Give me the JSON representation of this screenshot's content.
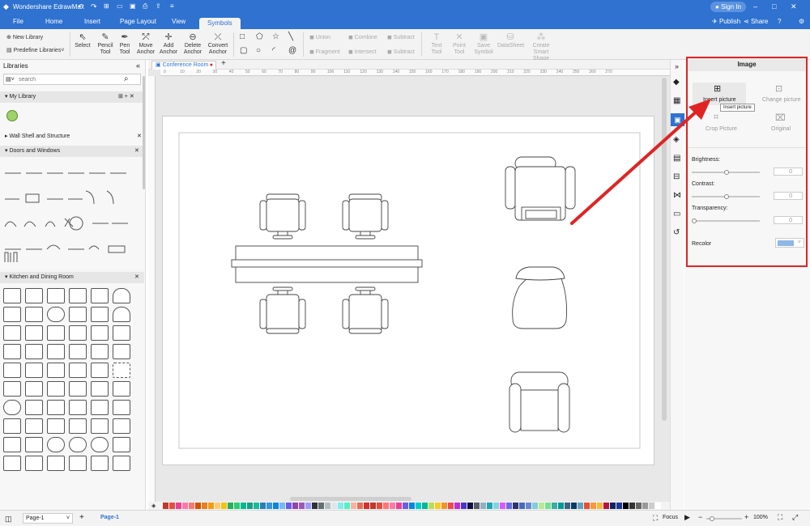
{
  "app": {
    "title": "Wondershare EdrawMax"
  },
  "title_right": {
    "sign_in": "Sign In",
    "publish": "Publish",
    "share": "Share"
  },
  "menu": [
    "File",
    "Home",
    "Insert",
    "Page Layout",
    "View",
    "Symbols"
  ],
  "ribbon": {
    "new_library": "New Library",
    "predefine_libraries": "Predefine Libraries",
    "select": "Select",
    "pencil_tool": [
      "Pencil",
      "Tool"
    ],
    "pen_tool": [
      "Pen",
      "Tool"
    ],
    "move_anchor": [
      "Move",
      "Anchor"
    ],
    "add_anchor": [
      "Add",
      "Anchor"
    ],
    "delete_anchor": [
      "Delete",
      "Anchor"
    ],
    "convert_anchor": [
      "Convert",
      "Anchor"
    ],
    "union": "Union",
    "combine": "Combine",
    "subtract": "Subtract",
    "fragment": "Fragment",
    "intersect": "Intersect",
    "subtract2": "Subtract",
    "text_tool": [
      "Text",
      "Tool"
    ],
    "point_tool": [
      "Point",
      "Tool"
    ],
    "save_symbol": [
      "Save",
      "Symbol"
    ],
    "datasheet": "DataSheet",
    "create_smart_shape": [
      "Create Smart",
      "Shape"
    ]
  },
  "libraries": {
    "title": "Libraries",
    "search_placeholder": "search",
    "sections": [
      "My Library",
      "Wall Shell and Structure",
      "Doors and Windows",
      "Kitchen and Dining Room"
    ]
  },
  "doc_tab": "Conference Room",
  "ruler_ticks": [
    "0",
    "10",
    "20",
    "30",
    "40",
    "50",
    "60",
    "70",
    "80",
    "90",
    "100",
    "110",
    "120",
    "130",
    "140",
    "150",
    "160",
    "170",
    "180",
    "190",
    "200",
    "210",
    "220",
    "230",
    "240",
    "250",
    "260",
    "270"
  ],
  "image_panel": {
    "title": "Image",
    "insert_picture": "Insert picture",
    "tooltip": "Insert picture",
    "change_picture": "Change picture",
    "crop_picture": "Crop Picture",
    "original": "Original",
    "brightness": "Brightness:",
    "brightness_value": "0",
    "contrast": "Contrast:",
    "contrast_value": "0",
    "transparency": "Transparency:",
    "transparency_value": "0",
    "recolor": "Recolor"
  },
  "status": {
    "page_select": "Page-1",
    "page_tab": "Page-1",
    "focus": "Focus",
    "zoom": "100%"
  },
  "colors": {
    "accent": "#2f72d0",
    "highlight": "#e02424",
    "palette": [
      "#c0392b",
      "#e74c3c",
      "#e84393",
      "#fd79a8",
      "#ff7675",
      "#d35400",
      "#e67e22",
      "#f39c12",
      "#fdcb6e",
      "#f1c40f",
      "#27ae60",
      "#2ecc71",
      "#00b894",
      "#16a085",
      "#1abc9c",
      "#2980b9",
      "#3498db",
      "#0984e3",
      "#74b9ff",
      "#6c5ce7",
      "#8e44ad",
      "#9b59b6",
      "#a29bfe",
      "#2d3436",
      "#636e72",
      "#b2bec3",
      "#dfe6e9",
      "#81ecec",
      "#55efc4",
      "#fab1a0",
      "#e17055",
      "#d63031",
      "#c0392b",
      "#e74c3c",
      "#ff7675",
      "#fd79a8",
      "#e84393",
      "#6c5ce7",
      "#0984e3",
      "#00cec9",
      "#00b894",
      "#badc58",
      "#f9ca24",
      "#f0932b",
      "#eb4d4b",
      "#be2edd",
      "#4834d4",
      "#130f40",
      "#535c68",
      "#95afc0",
      "#22a6b3",
      "#7ed6df",
      "#e056fd",
      "#686de0",
      "#30336b",
      "#4a69bd",
      "#6a89cc",
      "#82ccdd",
      "#b8e994",
      "#78e08f",
      "#38ada9",
      "#079992",
      "#3c6382",
      "#0a3d62",
      "#60a3bc",
      "#e55039",
      "#fa983a",
      "#f6b93b",
      "#b71540",
      "#0c2461",
      "#1e3799",
      "#000000",
      "#333333",
      "#666666",
      "#999999",
      "#cccccc",
      "#ffffff"
    ]
  }
}
